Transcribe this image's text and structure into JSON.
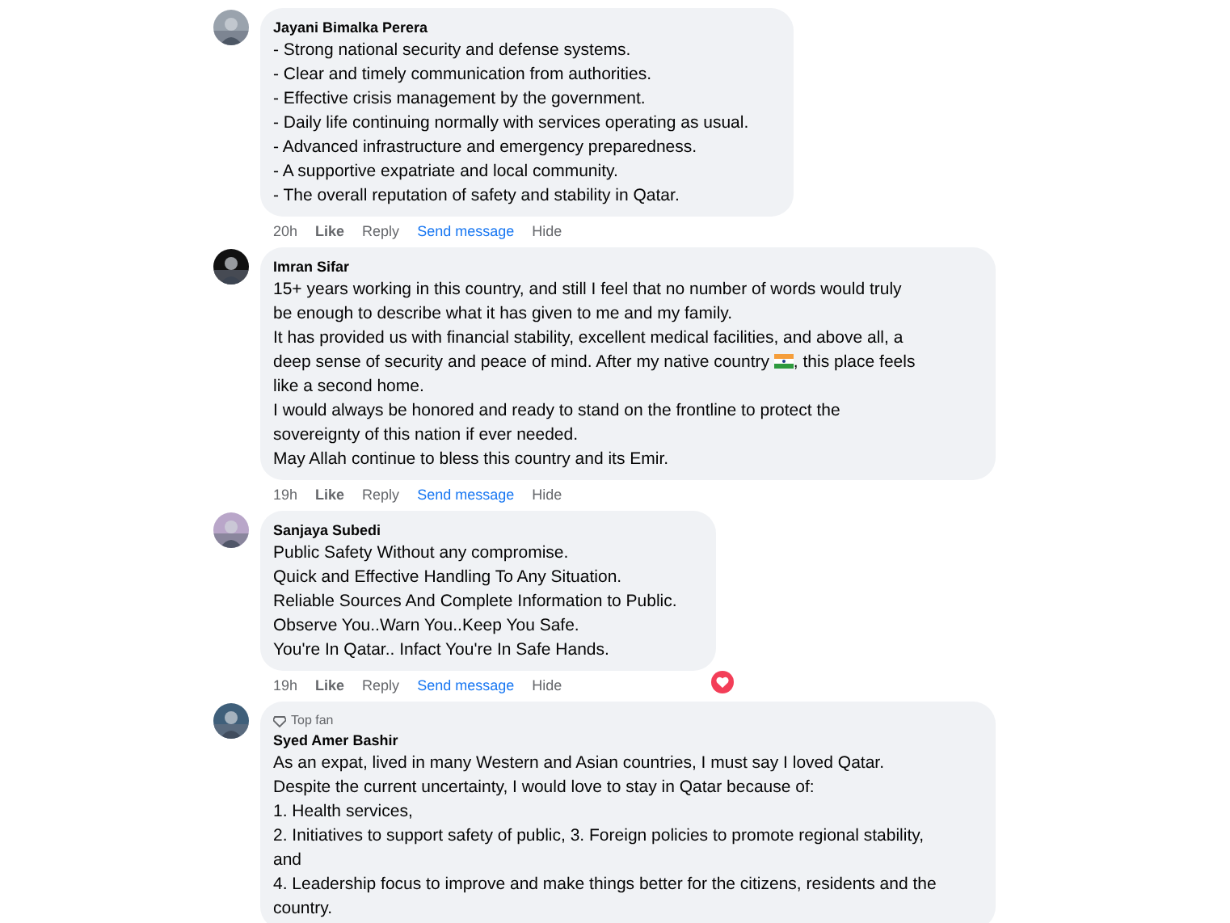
{
  "comments": [
    {
      "author": "Jayani Bimalka Perera",
      "avatar": {
        "kind": "picture"
      },
      "lines": [
        [
          {
            "text": "- Strong national security and defense systems."
          }
        ],
        [
          {
            "text": "- Clear and timely communication from authorities."
          }
        ],
        [
          {
            "text": "- Effective crisis management by the government."
          }
        ],
        [
          {
            "text": "- Daily life continuing normally with services operating as usual."
          }
        ],
        [
          {
            "text": "- Advanced infrastructure and emergency preparedness."
          }
        ],
        [
          {
            "text": "- A supportive expatriate and local community."
          }
        ],
        [
          {
            "text": "- The overall reputation of safety and stability in Qatar."
          }
        ]
      ],
      "time": "20h",
      "actions": [
        "Like",
        "Reply",
        "Send message",
        "Hide"
      ]
    },
    {
      "author": "Imran Sifar",
      "avatar": {
        "kind": "picture"
      },
      "lines": [
        [
          {
            "text": "15+ years working in this country, and still I feel that no number of words would truly"
          }
        ],
        [
          {
            "text": "be enough to describe what it has given to me and my family."
          }
        ],
        [
          {
            "text": "It has provided us with financial stability, excellent medical facilities, and above all, a"
          }
        ],
        [
          {
            "text": "deep sense of security and peace of mind. After my native country "
          },
          {
            "kind": "flag"
          },
          {
            "text": ", this place feels"
          }
        ],
        [
          {
            "text": "like a second home."
          }
        ],
        [
          {
            "text": "I would always be honored and ready to stand on the frontline to protect the"
          }
        ],
        [
          {
            "text": "sovereignty of this nation if ever needed."
          }
        ],
        [
          {
            "text": "May Allah continue to bless this country and its Emir."
          }
        ]
      ],
      "time": "19h",
      "actions": [
        "Like",
        "Reply",
        "Send message",
        "Hide"
      ]
    },
    {
      "author": "Sanjaya Subedi",
      "avatar": {
        "kind": "picture"
      },
      "lines": [
        [
          {
            "text": "Public Safety Without any compromise."
          }
        ],
        [
          {
            "text": "Quick and Effective Handling To Any Situation."
          }
        ],
        [
          {
            "text": "Reliable Sources And Complete Information to Public."
          }
        ],
        [
          {
            "text": "Observe You..Warn You..Keep You Safe."
          }
        ],
        [
          {
            "text": "You're In Qatar.. Infact You're In Safe Hands."
          }
        ]
      ],
      "time": "19h",
      "actions": [
        "Like",
        "Reply",
        "Send message",
        "Hide"
      ],
      "reaction": {
        "kind": "love"
      }
    },
    {
      "author": "Syed Amer Bashir",
      "badge": "Top fan",
      "avatar": {
        "kind": "picture"
      },
      "lines": [
        [
          {
            "text": "As an expat, lived in many Western and Asian countries, I must say I loved Qatar."
          }
        ],
        [
          {
            "text": "Despite the current uncertainty, I would love to stay in Qatar because of:"
          }
        ],
        [
          {
            "text": "1. Health services,"
          }
        ],
        [
          {
            "text": "2. Initiatives to support safety of public, 3. Foreign policies to promote regional stability,"
          }
        ],
        [
          {
            "text": "and"
          }
        ],
        [
          {
            "text": "4. Leadership focus to improve and make things better for the citizens, residents and the"
          }
        ],
        [
          {
            "text": "country."
          }
        ]
      ]
    }
  ]
}
